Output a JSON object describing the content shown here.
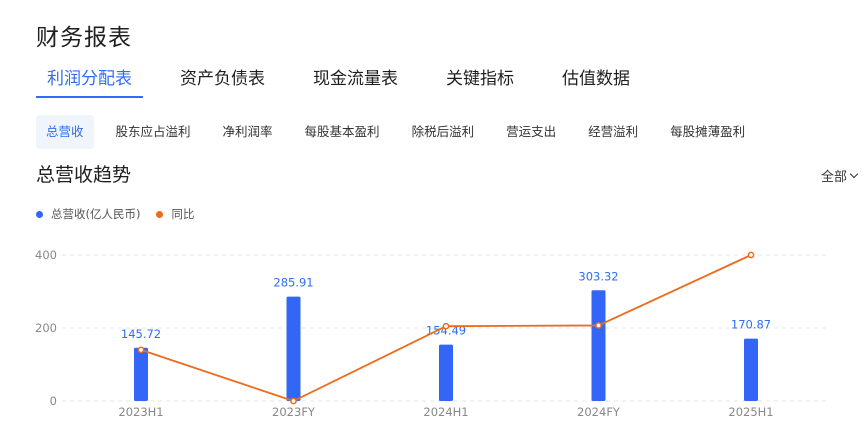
{
  "page": {
    "title": "财务报表"
  },
  "main_tabs": [
    {
      "label": "利润分配表",
      "active": true
    },
    {
      "label": "资产负债表",
      "active": false
    },
    {
      "label": "现金流量表",
      "active": false
    },
    {
      "label": "关键指标",
      "active": false
    },
    {
      "label": "估值数据",
      "active": false
    }
  ],
  "sub_tabs": [
    {
      "label": "总营收",
      "active": true
    },
    {
      "label": "股东应占溢利",
      "active": false
    },
    {
      "label": "净利润率",
      "active": false
    },
    {
      "label": "每股基本盈利",
      "active": false
    },
    {
      "label": "除税后溢利",
      "active": false
    },
    {
      "label": "营运支出",
      "active": false
    },
    {
      "label": "经营溢利",
      "active": false
    },
    {
      "label": "每股摊薄盈利",
      "active": false
    }
  ],
  "section": {
    "title": "总营收趋势",
    "range_label": "全部"
  },
  "colors": {
    "accent": "#2f6df6",
    "bar": "#3366f6",
    "line": "#ee6a1c",
    "grid": "#e4e4e4"
  },
  "chart_data": {
    "type": "bar",
    "categories": [
      "2023H1",
      "2023FY",
      "2024H1",
      "2024FY",
      "2025H1"
    ],
    "series": [
      {
        "name": "总营收(亿人民币)",
        "type": "bar",
        "axis": "left",
        "values": [
          145.72,
          285.91,
          154.49,
          303.32,
          170.87
        ],
        "labels": [
          "145.72",
          "285.91",
          "154.49",
          "303.32",
          "170.87"
        ]
      },
      {
        "name": "同比",
        "type": "line",
        "axis": "right",
        "values": [
          140,
          0,
          205,
          207,
          400
        ]
      }
    ],
    "y_ticks": [
      0,
      200,
      400
    ],
    "ylim": [
      0,
      400
    ],
    "grid": true,
    "legend": "top-left"
  }
}
